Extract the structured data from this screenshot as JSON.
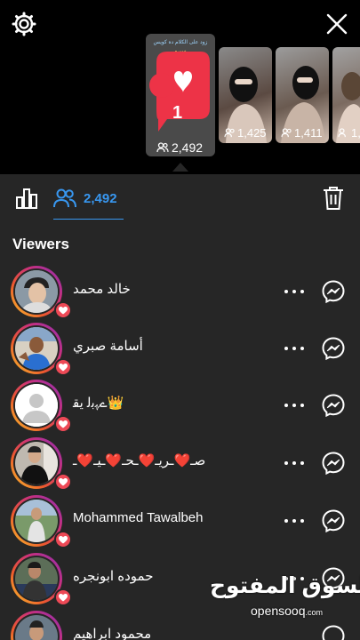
{
  "header": {
    "main_story": {
      "count": "2,492",
      "caption_text": "زود على الكلام ده كويس",
      "caption_sub": "سيرو",
      "like_count": "1"
    },
    "thumbnails": [
      {
        "count": "1,425"
      },
      {
        "count": "1,411"
      },
      {
        "count": "1,..."
      }
    ]
  },
  "tabs": {
    "viewers_count": "2,492"
  },
  "section": {
    "title": "Viewers"
  },
  "viewers": [
    {
      "name": "خالد محمد"
    },
    {
      "name": "أسامة صبري"
    },
    {
      "name": "ےﮩﺑﻟ ﻳﻘ👑"
    },
    {
      "name": "صـ❤️ـريـ❤️ـحـ❤️ـيـ❤️ـ"
    },
    {
      "name": "Mohammed Tawalbeh"
    },
    {
      "name": "حموده ابونجره"
    },
    {
      "name": "محمود ابراهيم"
    }
  ],
  "watermark": {
    "arabic": "السوق المفتوح",
    "english": "opensooq",
    "suffix": ".com"
  },
  "colors": {
    "accent": "#3897f0",
    "heart": "#ed4956",
    "background": "#262626",
    "top_background": "#000000"
  }
}
